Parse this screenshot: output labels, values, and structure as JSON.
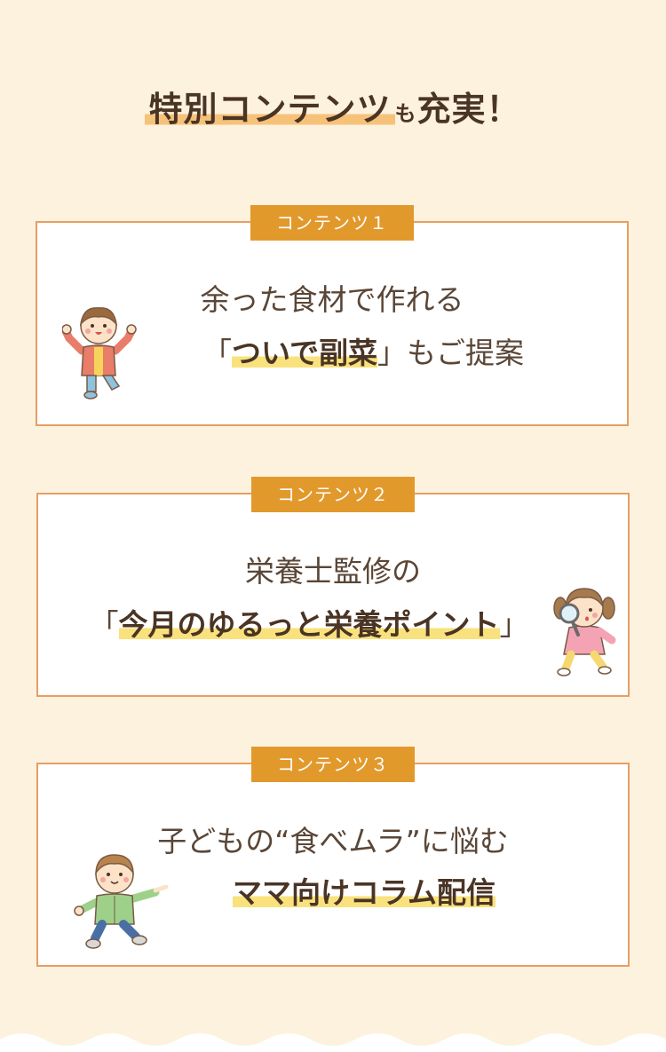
{
  "header": {
    "title_main": "特別コンテンツ",
    "title_particle": "も",
    "title_end": "充実！"
  },
  "cards": [
    {
      "badge": "コンテンツ１",
      "line1": "余った食材で作れる",
      "line2_open": "「",
      "line2_em": "ついで副菜",
      "line2_close": "」",
      "line2_rest": "もご提案",
      "character": "boy-arms-raised-icon"
    },
    {
      "badge": "コンテンツ２",
      "line1": "栄養士監修の",
      "line2_open": "「",
      "line2_em": "今月のゆるっと栄養ポイント",
      "line2_close": "」",
      "character": "girl-magnifying-glass-icon"
    },
    {
      "badge": "コンテンツ３",
      "line1": "子どもの“食べムラ”に悩む",
      "line2_em": "ママ向けコラム配信",
      "character": "boy-pointing-icon"
    }
  ],
  "colors": {
    "background": "#fdf2de",
    "badge": "#e2992c",
    "card_border": "#e79e63",
    "title_highlight": "#f6c27a",
    "text_highlight": "#f9e27d"
  }
}
